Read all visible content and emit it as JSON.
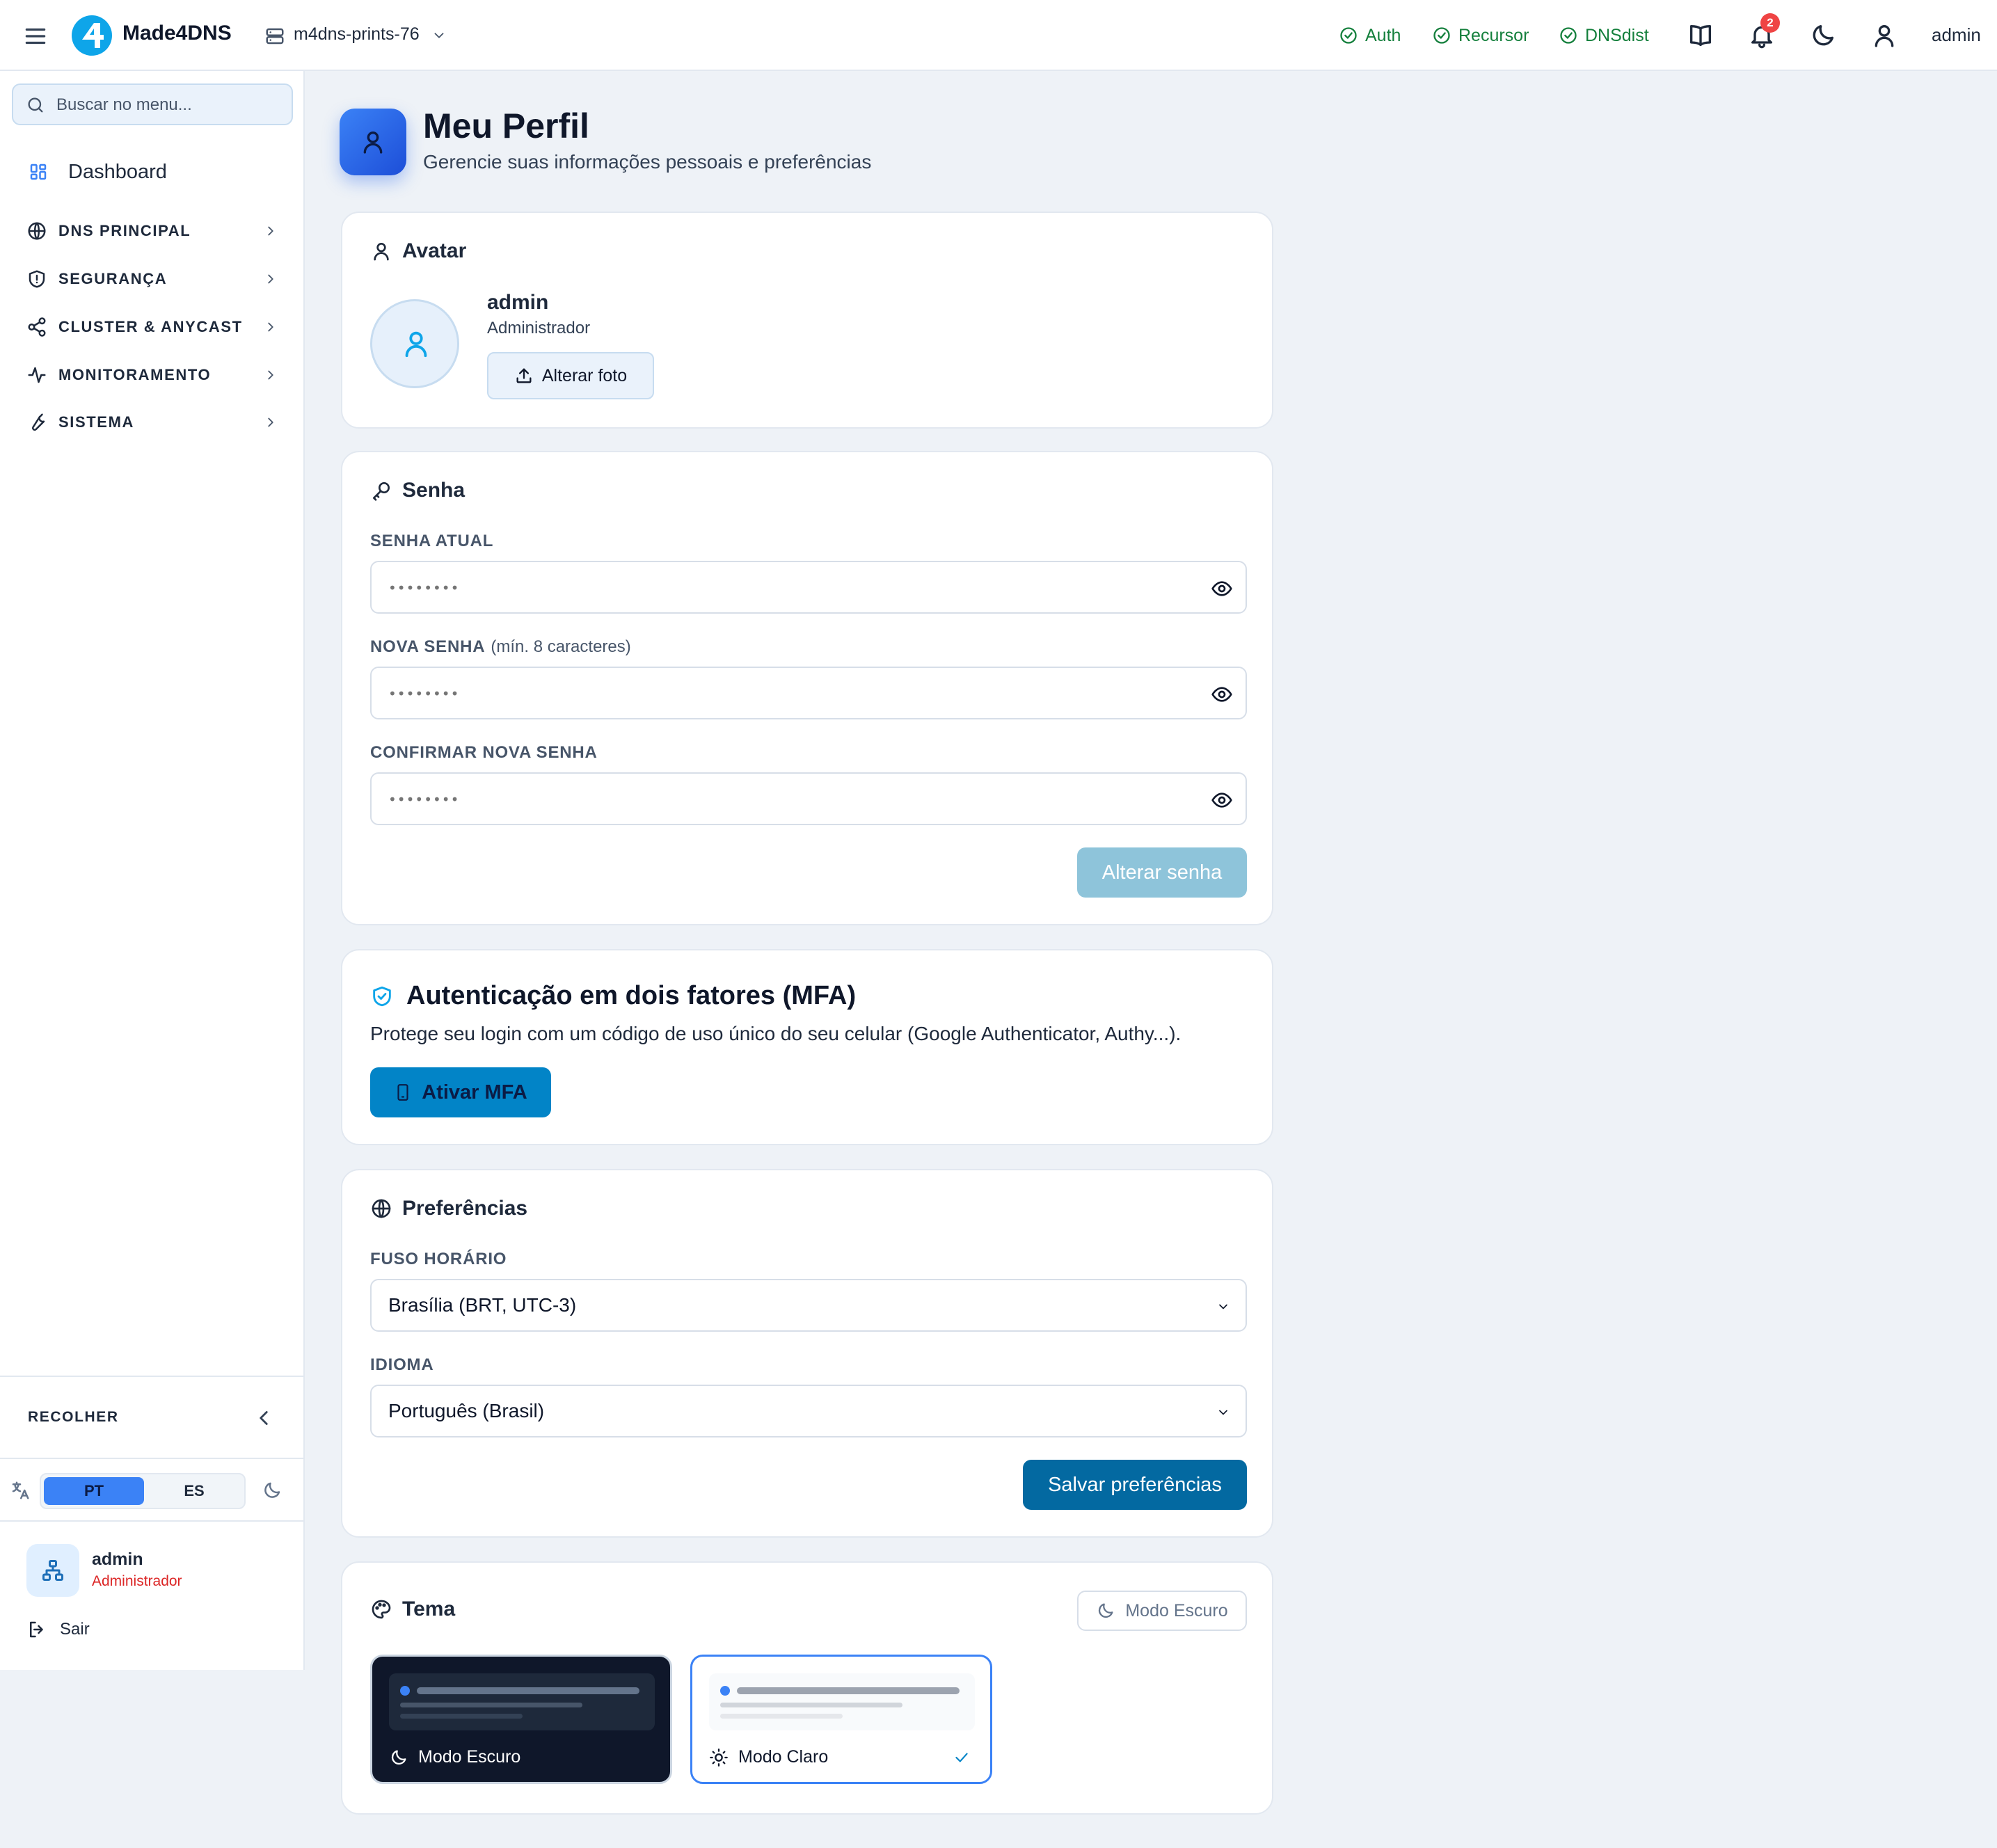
{
  "app": {
    "brand": "Made4DNS",
    "instance": "m4dns-prints-76"
  },
  "topbar": {
    "services": [
      {
        "label": "Auth",
        "status": "ok"
      },
      {
        "label": "Recursor",
        "status": "ok"
      },
      {
        "label": "DNSdist",
        "status": "ok"
      }
    ],
    "notification_count": "2",
    "user": "admin"
  },
  "sidebar": {
    "search_placeholder": "Buscar no menu...",
    "dashboard": "Dashboard",
    "sections": [
      {
        "label": "DNS PRINCIPAL",
        "icon": "globe-icon"
      },
      {
        "label": "SEGURANÇA",
        "icon": "shield-icon"
      },
      {
        "label": "CLUSTER & ANYCAST",
        "icon": "share-icon"
      },
      {
        "label": "MONITORAMENTO",
        "icon": "activity-icon"
      },
      {
        "label": "SISTEMA",
        "icon": "wrench-icon"
      }
    ],
    "collapse_label": "RECOLHER",
    "languages": [
      "PT",
      "ES"
    ],
    "active_language": "PT",
    "user_name": "admin",
    "user_role": "Administrador",
    "logout": "Sair"
  },
  "page": {
    "title": "Meu Perfil",
    "subtitle": "Gerencie suas informações pessoais e preferências"
  },
  "avatar_card": {
    "title": "Avatar",
    "name": "admin",
    "role": "Administrador",
    "change_photo": "Alterar foto"
  },
  "password_card": {
    "title": "Senha",
    "current_label": "SENHA ATUAL",
    "new_label": "NOVA SENHA",
    "new_hint": "(mín. 8 caracteres)",
    "confirm_label": "CONFIRMAR NOVA SENHA",
    "placeholder": "••••••••",
    "submit": "Alterar senha"
  },
  "mfa_card": {
    "title": "Autenticação em dois fatores (MFA)",
    "description": "Protege seu login com um código de uso único do seu celular (Google Authenticator, Authy...).",
    "button": "Ativar MFA"
  },
  "prefs_card": {
    "title": "Preferências",
    "timezone_label": "FUSO HORÁRIO",
    "timezone_value": "Brasília (BRT, UTC-3)",
    "language_label": "IDIOMA",
    "language_value": "Português (Brasil)",
    "submit": "Salvar preferências"
  },
  "theme_card": {
    "title": "Tema",
    "toggle": "Modo Escuro",
    "dark_option": "Modo Escuro",
    "light_option": "Modo Claro",
    "selected": "Modo Claro"
  },
  "colors": {
    "accent": "#3b82f6",
    "primary_button": "#0369a1",
    "disabled_button": "#8ec4da",
    "success": "#15803d",
    "danger": "#dc2626"
  }
}
